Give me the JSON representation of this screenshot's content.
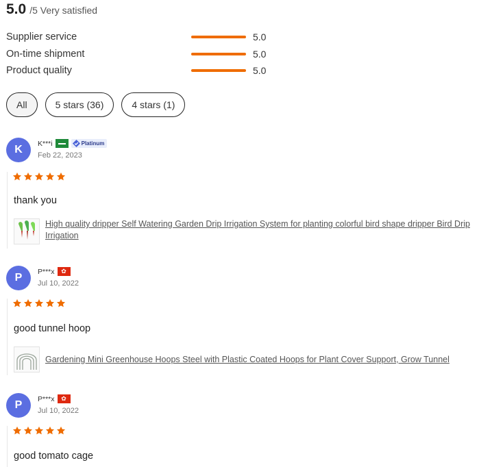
{
  "summary": {
    "score": "5.0",
    "suffix": "/5 Very satisfied"
  },
  "metrics": [
    {
      "label": "Supplier service",
      "value": "5.0",
      "fill_fraction": 1.0
    },
    {
      "label": "On-time shipment",
      "value": "5.0",
      "fill_fraction": 1.0
    },
    {
      "label": "Product quality",
      "value": "5.0",
      "fill_fraction": 1.0
    }
  ],
  "accent_color": "#ef6c00",
  "filters": [
    {
      "label": "All",
      "active": true
    },
    {
      "label": "5 stars (36)",
      "active": false
    },
    {
      "label": "4 stars (1)",
      "active": false
    }
  ],
  "reviews": [
    {
      "initial": "K",
      "name": "K***i",
      "flag": "saudi-arabia-flag-icon",
      "badge": "Platinum",
      "date": "Feb 22, 2023",
      "rating": 5,
      "text": "thank you",
      "product": "High quality dripper Self Watering Garden Drip Irrigation System for planting colorful bird shape dripper Bird Drip Irrigation",
      "thumb": "bird-dripper-icon"
    },
    {
      "initial": "P",
      "name": "P***x",
      "flag": "hong-kong-flag-icon",
      "date": "Jul 10, 2022",
      "rating": 5,
      "text": "good tunnel hoop",
      "product": "Gardening Mini Greenhouse Hoops Steel with Plastic Coated Hoops for Plant Cover Support, Grow Tunnel",
      "thumb": "greenhouse-hoops-icon"
    },
    {
      "initial": "P",
      "name": "P***x",
      "flag": "hong-kong-flag-icon",
      "date": "Jul 10, 2022",
      "rating": 5,
      "text": "good tomato cage"
    }
  ]
}
